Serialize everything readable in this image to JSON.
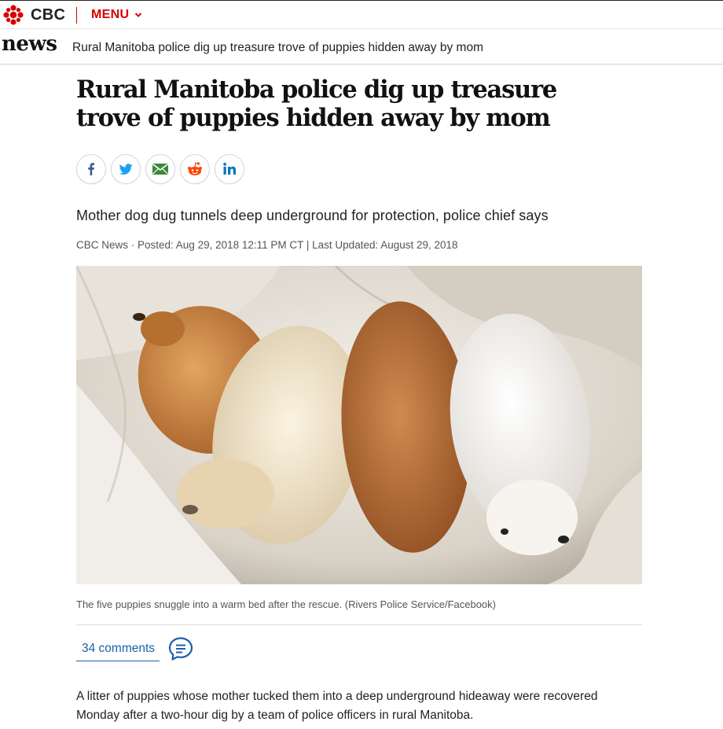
{
  "brand": {
    "name": "CBC",
    "accent_color": "#d80000",
    "gem_icon": "cbc-gem-icon"
  },
  "topbar": {
    "menu_label": "MENU",
    "menu_icon": "chevron-down-icon"
  },
  "newsbar": {
    "section": "news",
    "current_headline": "Rural Manitoba police dig up treasure trove of puppies hidden away by mom"
  },
  "article": {
    "headline": "Rural Manitoba police dig up treasure trove of puppies hidden away by mom",
    "share_buttons": [
      {
        "icon": "facebook-icon",
        "color": "#3b5998"
      },
      {
        "icon": "twitter-icon",
        "color": "#1da1f2"
      },
      {
        "icon": "email-icon",
        "color": "#3a8a3a"
      },
      {
        "icon": "reddit-icon",
        "color": "#ff4500"
      },
      {
        "icon": "linkedin-icon",
        "color": "#0077b5"
      }
    ],
    "deck": "Mother dog dug tunnels deep underground for protection, police chief says",
    "byline": "CBC News · Posted: Aug 29, 2018 12:11 PM CT | Last Updated: August 29, 2018",
    "photo_caption": "The five puppies snuggle into a warm bed after the rescue. (Rivers Police Service/Facebook)",
    "comments_label": "34 comments",
    "comments_icon": "comment-bubble-icon",
    "body_paragraph": "A litter of puppies whose mother tucked them into a deep underground hideaway were recovered Monday after a two-hour dig by a team of police officers in rural Manitoba."
  }
}
